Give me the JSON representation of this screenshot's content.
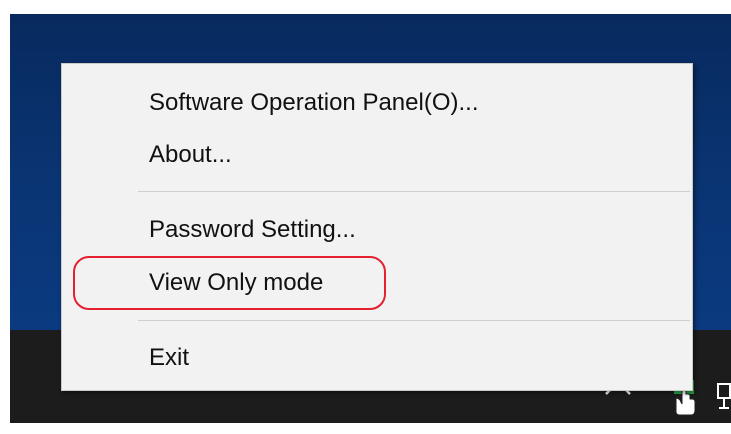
{
  "context_menu": {
    "items": [
      {
        "label": "Software Operation Panel(O)..."
      },
      {
        "label": "About..."
      },
      {
        "label": "Password Setting..."
      },
      {
        "label": "View Only mode"
      },
      {
        "label": "Exit"
      }
    ],
    "highlighted_item": "View Only mode"
  },
  "taskbar": {
    "tray_icons": [
      "chevron-up-icon",
      "scanner-app-icon",
      "network-icon"
    ]
  },
  "colors": {
    "desktop": "#0a3574",
    "taskbar": "#1c1c1c",
    "menu_background": "#f2f2f2",
    "highlight": "#e5202e"
  }
}
